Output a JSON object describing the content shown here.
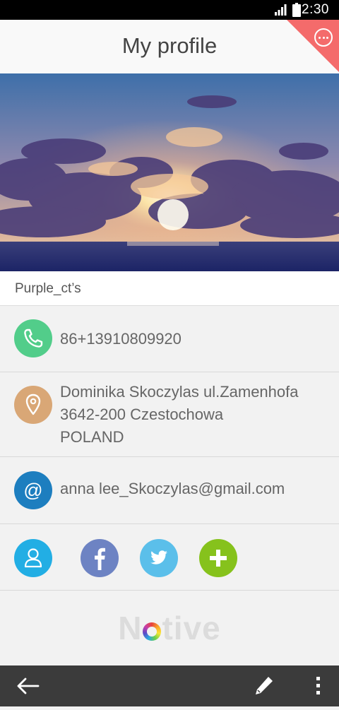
{
  "status_bar": {
    "time": "2:30"
  },
  "header": {
    "title": "My profile"
  },
  "profile": {
    "name": "Purple_ct’s"
  },
  "contact": {
    "phone": "86+13910809920",
    "address_line1": "Dominika Skoczylas ul.Zamenhofa",
    "address_line2": "3642-200 Czestochowa",
    "address_line3": "POLAND",
    "email": "anna lee_Skoczylas@gmail.com"
  },
  "brand": {
    "logo_before": "N",
    "logo_after": "tive"
  },
  "colors": {
    "phone_icon": "#52cd8a",
    "location_icon": "#d9a776",
    "email_icon": "#1d7ebf",
    "contact_icon": "#22aee4",
    "facebook_icon": "#6d83c3",
    "twitter_icon": "#5bbfea",
    "add_icon": "#86c21c",
    "corner_accent": "#f46b6b"
  },
  "icons": {
    "phone": "phone-icon",
    "location": "location-pin-icon",
    "email": "at-sign-icon",
    "contact": "person-icon",
    "facebook": "facebook-icon",
    "twitter": "twitter-icon",
    "add": "plus-icon",
    "more": "more-horizontal-icon",
    "back": "back-arrow-icon",
    "edit": "pencil-icon",
    "overflow": "more-vertical-icon"
  }
}
